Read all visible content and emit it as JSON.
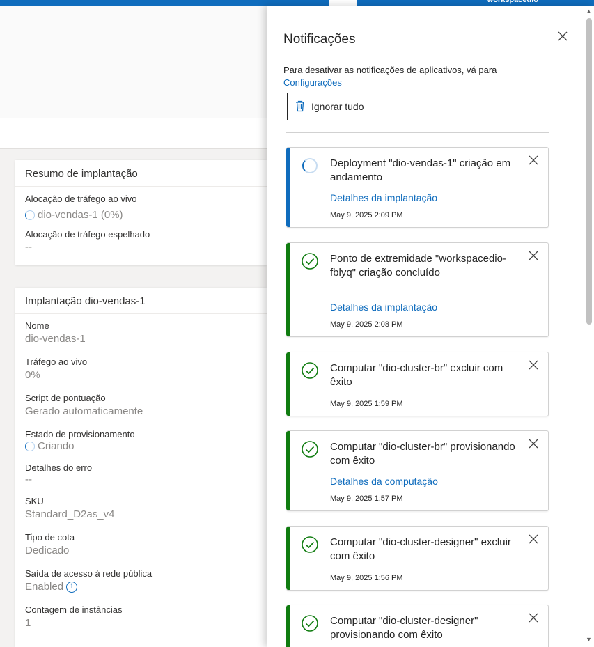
{
  "topbar": {
    "workspace_label": "workspacedio"
  },
  "summary_card": {
    "title": "Resumo de implantação",
    "fields": [
      {
        "label": "Alocação de tráfego ao vivo",
        "value": "dio-vendas-1 (0%)"
      },
      {
        "label": "Alocação de tráfego espelhado",
        "value": "--"
      }
    ]
  },
  "deployment_card": {
    "title": "Implantação dio-vendas-1",
    "fields": [
      {
        "label": "Nome",
        "value": "dio-vendas-1"
      },
      {
        "label": "Tráfego ao vivo",
        "value": "0%"
      },
      {
        "label": "Script de pontuação",
        "value": "Gerado automaticamente"
      },
      {
        "label": "Estado de provisionamento",
        "value": "Criando"
      },
      {
        "label": "Detalhes do erro",
        "value": "--"
      },
      {
        "label": "SKU",
        "value": "Standard_D2as_v4"
      },
      {
        "label": "Tipo de cota",
        "value": "Dedicado"
      },
      {
        "label": "Saída de acesso à rede pública",
        "value": "Enabled"
      },
      {
        "label": "Contagem de instâncias",
        "value": "1"
      }
    ]
  },
  "panel": {
    "title": "Notificações",
    "description": "Para desativar as notificações de aplicativos, vá para",
    "settings_link": "Configurações",
    "dismiss_all": "Ignorar tudo",
    "notifications": [
      {
        "status": "in-progress",
        "title": "Deployment \"dio-vendas-1\" criação em andamento",
        "link": "Detalhes da implantação",
        "time": "May 9, 2025 2:09 PM"
      },
      {
        "status": "success",
        "title": "Ponto de extremidade \"workspacedio-fblyq\" criação concluído",
        "link": "Detalhes da implantação",
        "time": "May 9, 2025 2:08 PM"
      },
      {
        "status": "success",
        "title": "Computar \"dio-cluster-br\" excluir com êxito",
        "link": "",
        "time": "May 9, 2025 1:59 PM"
      },
      {
        "status": "success",
        "title": "Computar \"dio-cluster-br\" provisionando com êxito",
        "link": "Detalhes da computação",
        "time": "May 9, 2025 1:57 PM"
      },
      {
        "status": "success",
        "title": "Computar \"dio-cluster-designer\" excluir com êxito",
        "link": "",
        "time": "May 9, 2025 1:56 PM"
      },
      {
        "status": "success",
        "title": "Computar \"dio-cluster-designer\" provisionando com êxito",
        "link": "",
        "time": ""
      }
    ]
  },
  "colors": {
    "accent": "#0f6cbd",
    "success": "#107c10"
  },
  "icons": {
    "close": "close-icon",
    "trash": "trash-icon",
    "success": "checkmark-circle-icon",
    "progress": "spinner-icon",
    "info": "info-icon"
  }
}
